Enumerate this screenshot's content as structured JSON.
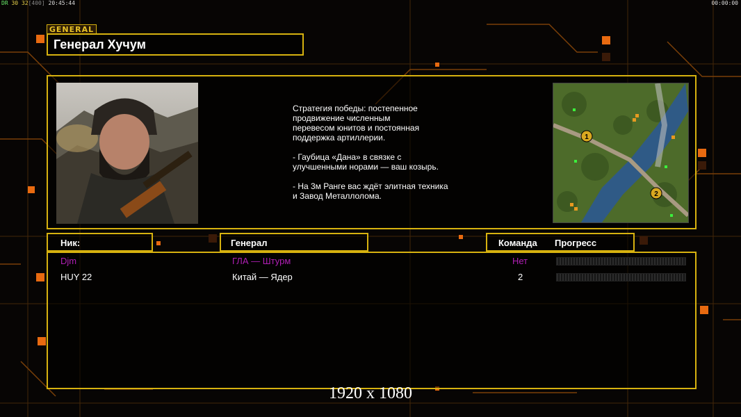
{
  "overlay": {
    "stats_prefix": "DR",
    "stats_fps": "30",
    "stats_frames": "32",
    "stats_cap": "[400]",
    "stats_time": "20:45:44",
    "clock": "00:00:00"
  },
  "general": {
    "tag": "GENERAL",
    "name": "Генерал Хучум",
    "description": "Стратегия победы: постепенное\nпродвижение численным\nперевесом юнитов и постоянная\nподдержка артиллерии.\n\n- Гаубица «Дана» в связке с\nулучшенными норами — ваш козырь.\n\n- На 3м Ранге вас ждёт элитная техника\nи Завод Металлолома.",
    "portrait_icon": "general-portrait"
  },
  "minimap": {
    "icon": "minimap-preview",
    "start_positions": [
      "1",
      "2"
    ]
  },
  "table": {
    "headers": {
      "nick": "Ник:",
      "general": "Генерал",
      "team": "Команда",
      "progress": "Прогресс"
    },
    "players": [
      {
        "nick": "Djm",
        "general": "ГЛА — Штурм",
        "team": "Нет",
        "color": "#b01fb4",
        "progress": 0
      },
      {
        "nick": "HUY 22",
        "general": "Китай — Ядер",
        "team": "2",
        "color": "#ffffff",
        "progress": 0
      }
    ]
  },
  "resolution": "1920 x 1080",
  "colors": {
    "accent": "#d7b20f",
    "orange": "#ff7a10",
    "player1": "#b01fb4"
  }
}
